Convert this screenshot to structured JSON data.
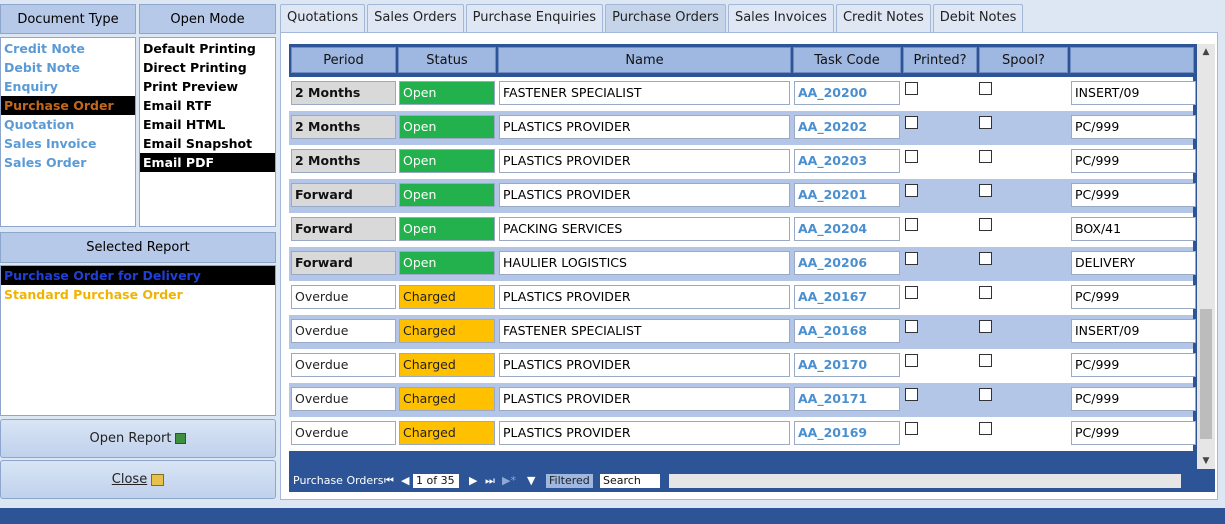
{
  "left": {
    "document_type_header": "Document Type",
    "open_mode_header": "Open Mode",
    "document_types": [
      {
        "label": "Credit Note",
        "color": "#5b9bd5",
        "selected": false
      },
      {
        "label": "Debit Note",
        "color": "#5b9bd5",
        "selected": false
      },
      {
        "label": "Enquiry",
        "color": "#5b9bd5",
        "selected": false
      },
      {
        "label": "Purchase Order",
        "color": "#c5671a",
        "selected": true
      },
      {
        "label": "Quotation",
        "color": "#5b9bd5",
        "selected": false
      },
      {
        "label": "Sales Invoice",
        "color": "#5b9bd5",
        "selected": false
      },
      {
        "label": "Sales Order",
        "color": "#5b9bd5",
        "selected": false
      }
    ],
    "open_modes": [
      {
        "label": "Default Printing",
        "selected": false
      },
      {
        "label": "Direct Printing",
        "selected": false
      },
      {
        "label": "Print Preview",
        "selected": false
      },
      {
        "label": "Email RTF",
        "selected": false
      },
      {
        "label": "Email HTML",
        "selected": false
      },
      {
        "label": "Email Snapshot",
        "selected": false
      },
      {
        "label": "Email PDF",
        "selected": true
      }
    ],
    "selected_report_header": "Selected Report",
    "reports": [
      {
        "label": "Purchase Order for Delivery",
        "color": "#1f3fd6",
        "selected": true
      },
      {
        "label": "Standard Purchase Order",
        "color": "#f0b400",
        "selected": false
      }
    ],
    "open_report_label": "Open Report",
    "close_label": "Close"
  },
  "tabs": [
    {
      "label": "Quotations",
      "active": false
    },
    {
      "label": "Sales Orders",
      "active": false
    },
    {
      "label": "Purchase Enquiries",
      "active": false
    },
    {
      "label": "Purchase Orders",
      "active": true
    },
    {
      "label": "Sales Invoices",
      "active": false
    },
    {
      "label": "Credit Notes",
      "active": false
    },
    {
      "label": "Debit Notes",
      "active": false
    }
  ],
  "grid": {
    "headers": {
      "period": "Period",
      "status": "Status",
      "name": "Name",
      "task_code": "Task Code",
      "printed": "Printed?",
      "spool": "Spool?",
      "ref": ""
    },
    "rows": [
      {
        "period": "2 Months",
        "status": "Open",
        "name": "FASTENER SPECIALIST",
        "task_code": "AA_20200",
        "printed": false,
        "spool": false,
        "ref": "INSERT/09"
      },
      {
        "period": "2 Months",
        "status": "Open",
        "name": "PLASTICS PROVIDER",
        "task_code": "AA_20202",
        "printed": false,
        "spool": false,
        "ref": "PC/999"
      },
      {
        "period": "2 Months",
        "status": "Open",
        "name": "PLASTICS PROVIDER",
        "task_code": "AA_20203",
        "printed": false,
        "spool": false,
        "ref": "PC/999"
      },
      {
        "period": "Forward",
        "status": "Open",
        "name": "PLASTICS PROVIDER",
        "task_code": "AA_20201",
        "printed": false,
        "spool": false,
        "ref": "PC/999"
      },
      {
        "period": "Forward",
        "status": "Open",
        "name": "PACKING SERVICES",
        "task_code": "AA_20204",
        "printed": false,
        "spool": false,
        "ref": "BOX/41"
      },
      {
        "period": "Forward",
        "status": "Open",
        "name": "HAULIER LOGISTICS",
        "task_code": "AA_20206",
        "printed": false,
        "spool": false,
        "ref": "DELIVERY"
      },
      {
        "period": "Overdue",
        "status": "Charged",
        "name": "PLASTICS PROVIDER",
        "task_code": "AA_20167",
        "printed": false,
        "spool": false,
        "ref": "PC/999"
      },
      {
        "period": "Overdue",
        "status": "Charged",
        "name": "FASTENER SPECIALIST",
        "task_code": "AA_20168",
        "printed": false,
        "spool": false,
        "ref": "INSERT/09"
      },
      {
        "period": "Overdue",
        "status": "Charged",
        "name": "PLASTICS PROVIDER",
        "task_code": "AA_20170",
        "printed": false,
        "spool": false,
        "ref": "PC/999"
      },
      {
        "period": "Overdue",
        "status": "Charged",
        "name": "PLASTICS PROVIDER",
        "task_code": "AA_20171",
        "printed": false,
        "spool": false,
        "ref": "PC/999"
      },
      {
        "period": "Overdue",
        "status": "Charged",
        "name": "PLASTICS PROVIDER",
        "task_code": "AA_20169",
        "printed": false,
        "spool": false,
        "ref": "PC/999"
      }
    ],
    "nav": {
      "form_name": "Purchase Orders",
      "record_position": "1 of 35",
      "filter_label": "Filtered",
      "search_label": "Search"
    }
  }
}
